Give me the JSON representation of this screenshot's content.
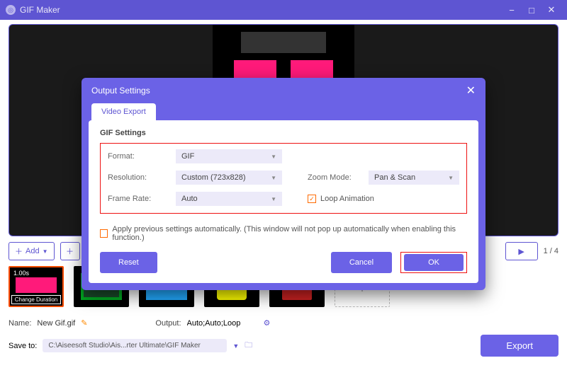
{
  "titlebar": {
    "app_name": "GIF Maker"
  },
  "toolbar": {
    "add_label": "Add"
  },
  "pager": {
    "current": "1",
    "total": "4"
  },
  "thumb": {
    "duration": "1.00s",
    "change_label": "Change Duration"
  },
  "footer": {
    "name_label": "Name:",
    "name_value": "New Gif.gif",
    "output_label": "Output:",
    "output_value": "Auto;Auto;Loop",
    "save_label": "Save to:",
    "save_path": "C:\\Aiseesoft Studio\\Ais...rter Ultimate\\GIF Maker",
    "export_label": "Export"
  },
  "dialog": {
    "title": "Output Settings",
    "tab": "Video Export",
    "section": "GIF Settings",
    "format_label": "Format:",
    "format_value": "GIF",
    "resolution_label": "Resolution:",
    "resolution_value": "Custom (723x828)",
    "zoom_label": "Zoom Mode:",
    "zoom_value": "Pan & Scan",
    "framerate_label": "Frame Rate:",
    "framerate_value": "Auto",
    "loop_label": "Loop Animation",
    "auto_apply": "Apply previous settings automatically. (This window will not pop up automatically when enabling this function.)",
    "reset": "Reset",
    "cancel": "Cancel",
    "ok": "OK"
  }
}
